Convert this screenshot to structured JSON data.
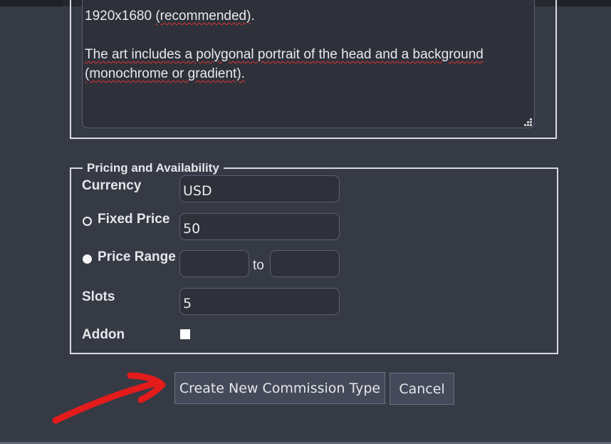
{
  "description": {
    "lines": [
      {
        "text": "1920x1680 ",
        "spell": "(recommended)",
        "after": "."
      },
      {
        "blank": true
      },
      {
        "text": "The art includes a polygonal portrait of the head and a background"
      },
      {
        "text": "(monochrome or gradient)."
      }
    ]
  },
  "pricing": {
    "legend": "Pricing and Availability",
    "currency": {
      "label": "Currency",
      "value": "USD"
    },
    "fixed_price": {
      "label": "Fixed Price",
      "value": "50",
      "selected": false
    },
    "price_range": {
      "label": "Price Range",
      "from": "",
      "to_label": "to",
      "to": "",
      "selected": true
    },
    "slots": {
      "label": "Slots",
      "value": "5"
    },
    "addon": {
      "label": "Addon",
      "checked": false
    }
  },
  "actions": {
    "create_label": "Create New Commission Type",
    "cancel_label": "Cancel"
  },
  "annotation": {
    "color": "#e31b1b",
    "shape": "arrow pointing to create button"
  }
}
